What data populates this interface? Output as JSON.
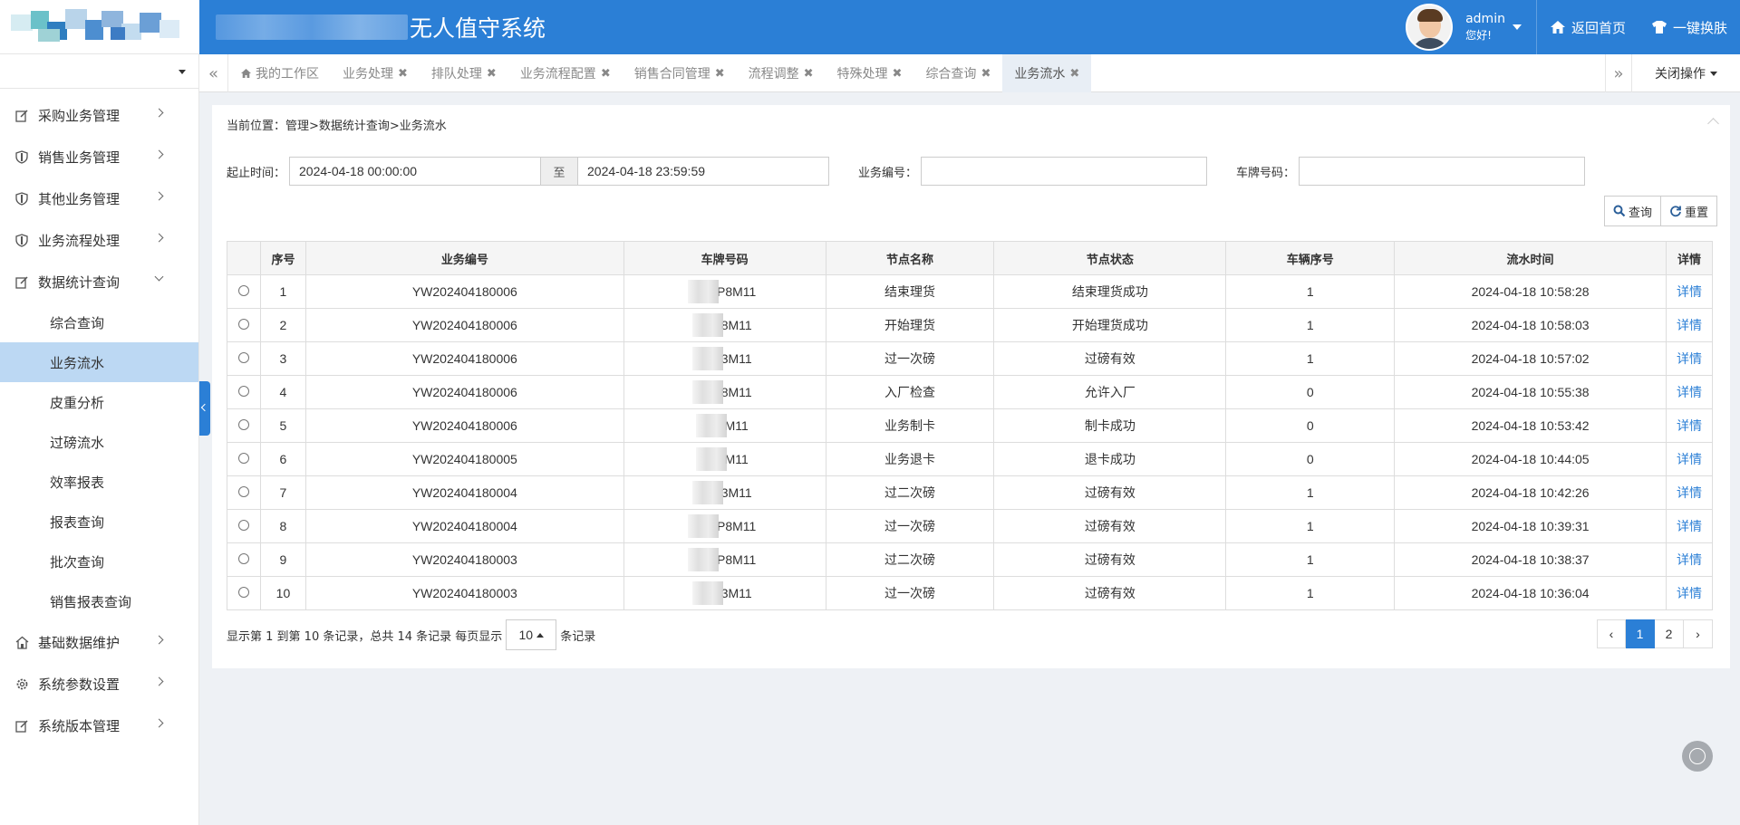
{
  "app": {
    "title": "无人值守系统"
  },
  "header": {
    "user_name": "admin",
    "user_greeting": "您好!",
    "home_label": "返回首页",
    "skin_label": "一键换肤"
  },
  "sidebar": {
    "menu": [
      {
        "label": "采购业务管理"
      },
      {
        "label": "销售业务管理"
      },
      {
        "label": "其他业务管理"
      },
      {
        "label": "业务流程处理"
      },
      {
        "label": "数据统计查询"
      },
      {
        "label": "基础数据维护"
      },
      {
        "label": "系统参数设置"
      },
      {
        "label": "系统版本管理"
      }
    ],
    "submenu": [
      {
        "label": "综合查询"
      },
      {
        "label": "业务流水"
      },
      {
        "label": "皮重分析"
      },
      {
        "label": "过磅流水"
      },
      {
        "label": "效率报表"
      },
      {
        "label": "报表查询"
      },
      {
        "label": "批次查询"
      },
      {
        "label": "销售报表查询"
      }
    ]
  },
  "tabs": {
    "items": [
      {
        "label": "我的工作区"
      },
      {
        "label": "业务处理"
      },
      {
        "label": "排队处理"
      },
      {
        "label": "业务流程配置"
      },
      {
        "label": "销售合同管理"
      },
      {
        "label": "流程调整"
      },
      {
        "label": "特殊处理"
      },
      {
        "label": "综合查询"
      },
      {
        "label": "业务流水"
      }
    ],
    "close_ops": "关闭操作"
  },
  "page": {
    "breadcrumb": "当前位置：管理>数据统计查询>业务流水",
    "time_label": "起止时间：",
    "start_time": "2024-04-18 00:00:00",
    "to_label": "至",
    "end_time": "2024-04-18 23:59:59",
    "biz_no_label": "业务编号：",
    "biz_no_value": "",
    "plate_label": "车牌号码：",
    "plate_value": "",
    "search_btn": "查询",
    "reset_btn": "重置"
  },
  "table": {
    "headers": [
      "序号",
      "业务编号",
      "车牌号码",
      "节点名称",
      "节点状态",
      "车辆序号",
      "流水时间",
      "详情"
    ],
    "rows": [
      {
        "no": "1",
        "biz": "YW202404180006",
        "plate": "P8M11",
        "node": "结束理货",
        "status": "结束理货成功",
        "seq": "1",
        "time": "2024-04-18 10:58:28",
        "detail": "详情"
      },
      {
        "no": "2",
        "biz": "YW202404180006",
        "plate": "8M11",
        "node": "开始理货",
        "status": "开始理货成功",
        "seq": "1",
        "time": "2024-04-18 10:58:03",
        "detail": "详情"
      },
      {
        "no": "3",
        "biz": "YW202404180006",
        "plate": "3M11",
        "node": "过一次磅",
        "status": "过磅有效",
        "seq": "1",
        "time": "2024-04-18 10:57:02",
        "detail": "详情"
      },
      {
        "no": "4",
        "biz": "YW202404180006",
        "plate": "8M11",
        "node": "入厂检查",
        "status": "允许入厂",
        "seq": "0",
        "time": "2024-04-18 10:55:38",
        "detail": "详情"
      },
      {
        "no": "5",
        "biz": "YW202404180006",
        "plate": "M11",
        "node": "业务制卡",
        "status": "制卡成功",
        "seq": "0",
        "time": "2024-04-18 10:53:42",
        "detail": "详情"
      },
      {
        "no": "6",
        "biz": "YW202404180005",
        "plate": "M11",
        "node": "业务退卡",
        "status": "退卡成功",
        "seq": "0",
        "time": "2024-04-18 10:44:05",
        "detail": "详情"
      },
      {
        "no": "7",
        "biz": "YW202404180004",
        "plate": "3M11",
        "node": "过二次磅",
        "status": "过磅有效",
        "seq": "1",
        "time": "2024-04-18 10:42:26",
        "detail": "详情"
      },
      {
        "no": "8",
        "biz": "YW202404180004",
        "plate": "P8M11",
        "node": "过一次磅",
        "status": "过磅有效",
        "seq": "1",
        "time": "2024-04-18 10:39:31",
        "detail": "详情"
      },
      {
        "no": "9",
        "biz": "YW202404180003",
        "plate": "P8M11",
        "node": "过二次磅",
        "status": "过磅有效",
        "seq": "1",
        "time": "2024-04-18 10:38:37",
        "detail": "详情"
      },
      {
        "no": "10",
        "biz": "YW202404180003",
        "plate": "3M11",
        "node": "过一次磅",
        "status": "过磅有效",
        "seq": "1",
        "time": "2024-04-18 10:36:04",
        "detail": "详情"
      }
    ]
  },
  "footer": {
    "summary": "显示第 1 到第 10 条记录，总共 14 条记录 每页显示",
    "page_size": "10",
    "suffix": "条记录"
  },
  "pager": {
    "prev": "‹",
    "pages": [
      "1",
      "2"
    ],
    "next": "›"
  },
  "colors": {
    "primary": "#2b7fd6",
    "active_menu": "#bcd8f3",
    "link": "#2b7fd6"
  }
}
